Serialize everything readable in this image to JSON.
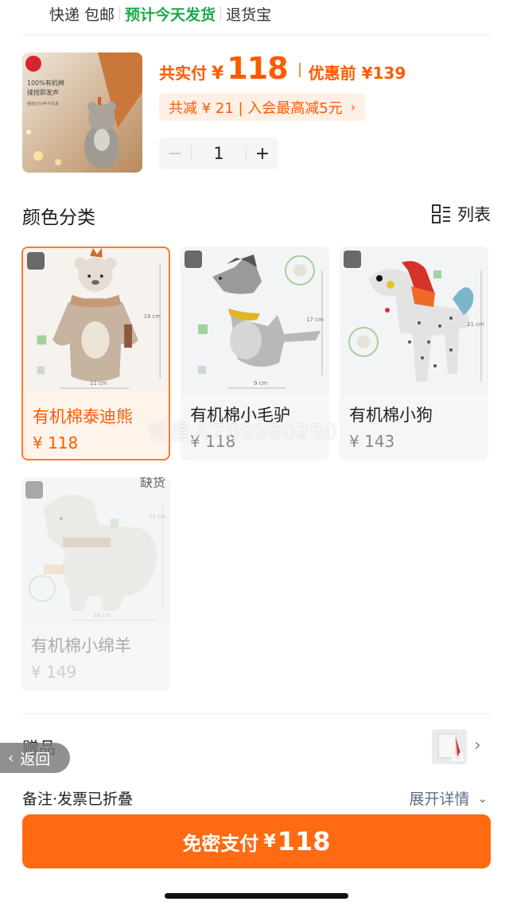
{
  "shipping": {
    "express": "快递 包邮",
    "ship_today": "预计今天发货",
    "return": "退货宝"
  },
  "product": {
    "thumb_lines": [
      "100%有机棉",
      "揉捏即发声",
      "啪啦沙沙声不失真"
    ],
    "pay_label": "共实付",
    "currency": "¥",
    "pay_amount": "118",
    "before_label": "优惠前 ¥139",
    "discount_text": "共减 ¥ 21 | 入会最高减5元",
    "quantity": "1",
    "minus": "−",
    "plus": "+"
  },
  "variants": {
    "section_title": "颜色分类",
    "view_label": "列表",
    "items": [
      {
        "name": "有机棉泰迪熊",
        "price": "¥ 118",
        "size_h": "19 cm",
        "size_w": "11 cm",
        "state": "selected"
      },
      {
        "name": "有机棉小毛驴",
        "price": "¥ 118",
        "size_h": "17 cm",
        "size_w": "9 cm",
        "state": "normal"
      },
      {
        "name": "有机棉小狗",
        "price": "¥ 143",
        "size_h": "21 cm",
        "state": "normal"
      },
      {
        "name": "有机棉小绵羊",
        "price": "¥ 149",
        "size_h": "15 cm",
        "size_w": "16 cm",
        "state": "out_of_stock",
        "stock_tag": "缺货"
      }
    ]
  },
  "watermark": "慢星人709990250",
  "gift": {
    "label": "赠品",
    "qty": "x1"
  },
  "back_button": "返回",
  "remark": {
    "label": "备注·发票已折叠",
    "expand": "展开详情"
  },
  "pay_button": {
    "label": "免密支付",
    "currency": "¥",
    "amount": "118"
  },
  "colors": {
    "accent": "#ff5a00",
    "button": "#ff6a13",
    "green": "#1ea84a"
  }
}
